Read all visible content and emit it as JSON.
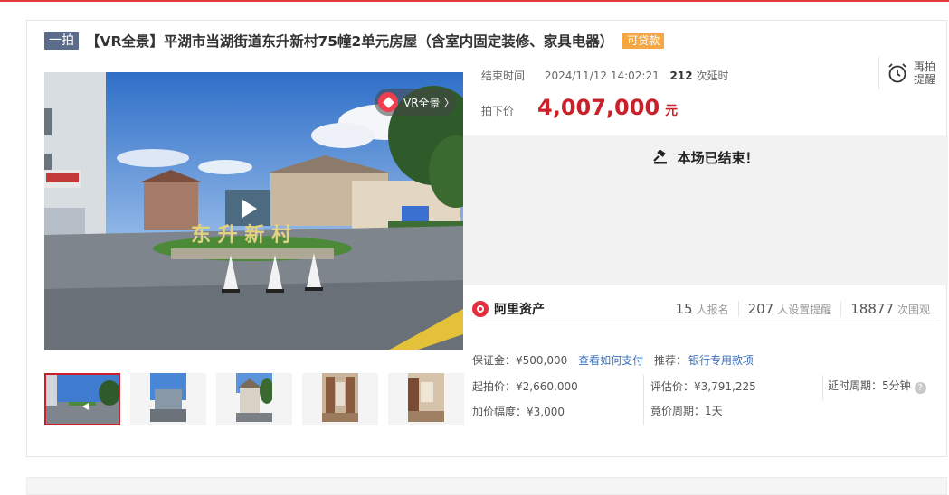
{
  "title": {
    "brand_badge": "一拍",
    "text": "【VR全景】平湖市当湖街道东升新村75幢2单元房屋（含室内固定装修、家具电器）",
    "loan_badge": "可贷款"
  },
  "media": {
    "vr_label": "VR全景",
    "vr_arrow": "〉"
  },
  "auction": {
    "end_label": "结束时间",
    "end_time": "2024/11/12 14:02:21",
    "delay_count": "212",
    "delay_suffix": "次延时",
    "remind_label": "再拍提醒",
    "price_label": "拍下价",
    "price": "4,007,000",
    "price_unit": "元",
    "ended_message": "本场已结束！"
  },
  "platform": {
    "name": "阿里资产"
  },
  "stats": [
    {
      "num": "15",
      "label": "人报名"
    },
    {
      "num": "207",
      "label": "人设置提醒"
    },
    {
      "num": "18877",
      "label": "次围观"
    }
  ],
  "details": {
    "deposit_label": "保证金：",
    "deposit_value": "¥500,000",
    "pay_link": "查看如何支付",
    "recommend_label": "推荐：",
    "recommend_link": "银行专用款项",
    "start_label": "起拍价：",
    "start_value": "¥2,660,000",
    "appraise_label": "评估价：",
    "appraise_value": "¥3,791,225",
    "delay_period_label": "延时周期：",
    "delay_period_value": "5分钟",
    "increment_label": "加价幅度：",
    "increment_value": "¥3,000",
    "bid_period_label": "竟价周期：",
    "bid_period_value": "1天"
  },
  "colors": {
    "accent_red": "#c9202a",
    "link_blue": "#3a6fb8",
    "loan_orange": "#f4a742",
    "badge_slate": "#5b6b8a"
  }
}
